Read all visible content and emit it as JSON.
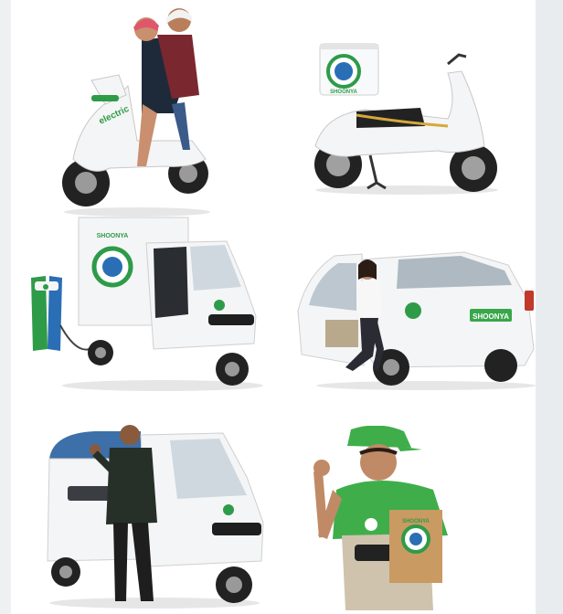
{
  "brand": {
    "logo_text": "SHOONYA",
    "box_badge_text": "SHOONYA",
    "car_plate_text": "SHOONYA",
    "scooter_decal_text": "electric",
    "bag_label_text": "SHOONYA"
  },
  "colors": {
    "brand_green": "#2e9b48",
    "brand_blue": "#2a6fb5",
    "shirt_green": "#3fae4a",
    "vehicle_white": "#f4f5f6",
    "tire_black": "#1f1f1f",
    "rickshaw_roof_blue": "#3d6fa8",
    "bag_kraft": "#c99a62"
  }
}
